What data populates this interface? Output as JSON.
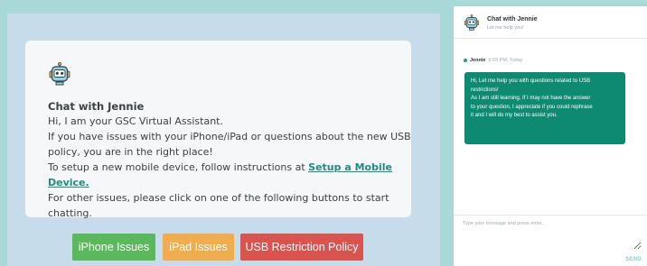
{
  "card": {
    "icon": "robot-icon",
    "title": "Chat with Jennie",
    "lines": [
      "Hi, I am your GSC Virtual Assistant.",
      "If you have issues with your iPhone/iPad or questions about the new USB",
      "policy, you are in the right place!"
    ],
    "setup_prefix": "To setup a new mobile device, follow instructions at ",
    "setup_link": "Setup a Mobile Device.",
    "other_lines": [
      "For other issues, please click on one of the following buttons to start",
      "chatting."
    ]
  },
  "buttons": {
    "iphone": "iPhone Issues",
    "ipad": "iPad Issues",
    "usb": "USB Restriction Policy"
  },
  "chat": {
    "avatar": "robot-icon",
    "title": "Chat with Jennie",
    "subtitle": "Let me help you!",
    "message": {
      "sender": "Jennie",
      "time": "6:59 PM, Today",
      "lines": [
        "Hi, Let me help you with questions related to USB",
        "restrictions!",
        "As I am still learning, If I may not have the answer",
        "to your question, I appreciate if you could rephrase",
        "it and I will do my best to assist you."
      ]
    },
    "input_placeholder": "Type your message and press enter..",
    "send_label": "SEND"
  },
  "colors": {
    "background": "#a9d8d9",
    "panel": "#c6dcea",
    "accent": "#0f8a72",
    "link": "#1f8b82",
    "iphone_button": "#5cb85c",
    "ipad_button": "#f0ad4e",
    "usb_button": "#d9534f"
  }
}
